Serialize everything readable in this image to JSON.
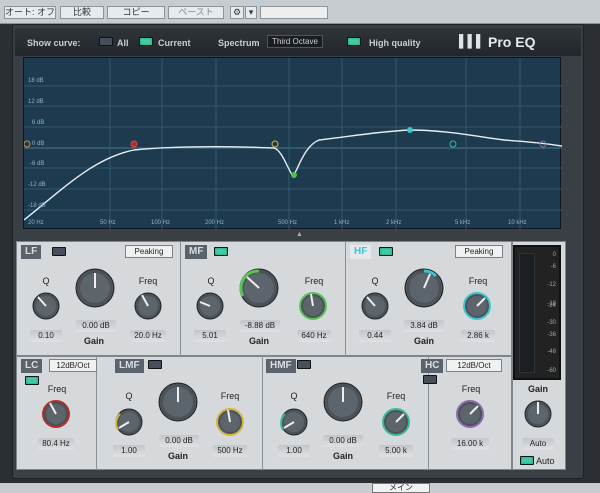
{
  "toolbar": {
    "auto_off_label": "オート: オフ",
    "compare_label": "比較",
    "copy_label": "コピー",
    "paste_label": "ペースト",
    "gear_icon": "gear-icon",
    "dropdown_icon": "chevron-down-icon"
  },
  "header": {
    "show_curve_label": "Show curve:",
    "all_label": "All",
    "current_label": "Current",
    "spectrum_label": "Spectrum",
    "spectrum_value": "Third Octave",
    "high_quality_label": "High quality",
    "brand": "Pro EQ",
    "all_on": false,
    "current_on": true,
    "high_quality_on": true
  },
  "graph": {
    "y_labels": [
      "18 dB",
      "12 dB",
      "6 dB",
      "0 dB",
      "-6 dB",
      "-12 dB",
      "-18 dB"
    ],
    "x_labels": [
      "20 Hz",
      "50 Hz",
      "100 Hz",
      "200 Hz",
      "500 Hz",
      "1 kHz",
      "2 kHz",
      "5 kHz",
      "10 kHz"
    ],
    "collapse_icon": "triangle-up-icon"
  },
  "bands": {
    "lf": {
      "title": "LF",
      "mode": "Peaking",
      "q_label": "Q",
      "gain_label": "Gain",
      "freq_label": "Freq",
      "q": "0.10",
      "gain": "0.00 dB",
      "freq": "20.0 Hz",
      "on": false
    },
    "mf": {
      "title": "MF",
      "q_label": "Q",
      "gain_label": "Gain",
      "freq_label": "Freq",
      "q": "5.01",
      "gain": "-8.88 dB",
      "freq": "640 Hz",
      "on": true
    },
    "hf": {
      "title": "HF",
      "mode": "Peaking",
      "q_label": "Q",
      "gain_label": "Gain",
      "freq_label": "Freq",
      "q": "0.44",
      "gain": "3.84 dB",
      "freq": "2.86 k",
      "on": true
    },
    "lc": {
      "title": "LC",
      "mode": "12dB/Oct",
      "freq_label": "Freq",
      "freq": "80.4 Hz",
      "on": true
    },
    "lmf": {
      "title": "LMF",
      "q_label": "Q",
      "gain_label": "Gain",
      "freq_label": "Freq",
      "q": "1.00",
      "gain": "0.00 dB",
      "freq": "500 Hz",
      "on": false
    },
    "hmf": {
      "title": "HMF",
      "q_label": "Q",
      "gain_label": "Gain",
      "freq_label": "Freq",
      "q": "1.00",
      "gain": "0.00 dB",
      "freq": "5.00 k",
      "on": false
    },
    "hc": {
      "title": "HC",
      "mode": "12dB/Oct",
      "freq_label": "Freq",
      "freq": "16.00 k",
      "on": false
    }
  },
  "output": {
    "meter_scale": [
      "0",
      "-6",
      "-12",
      "-18",
      "-24",
      "-30",
      "-36",
      "-48",
      "-60"
    ],
    "gain_label": "Gain",
    "gain_value": "Auto",
    "auto_label": "Auto",
    "auto_on": true
  },
  "footer": {
    "main_label": "メイン"
  }
}
